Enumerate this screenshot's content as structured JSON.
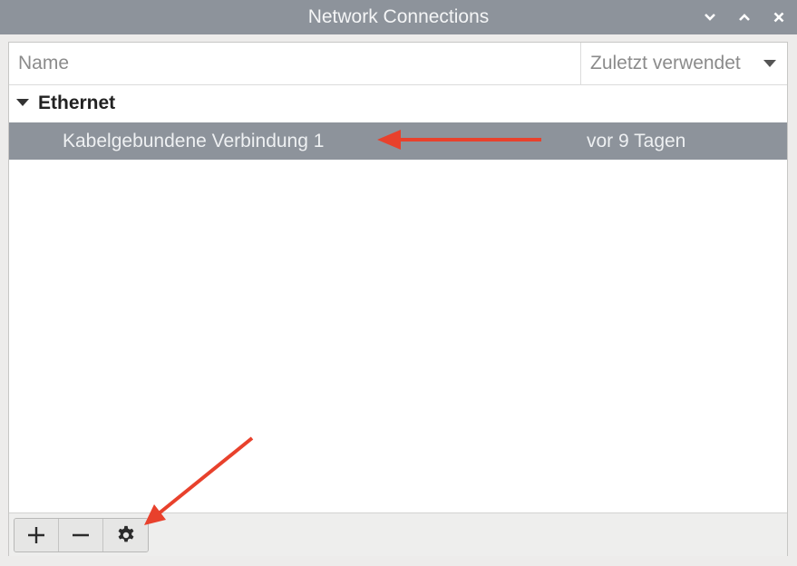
{
  "window": {
    "title": "Network Connections",
    "controls": [
      "chevron-down-icon",
      "chevron-up-icon",
      "close-icon"
    ]
  },
  "list": {
    "columns": {
      "name": "Name",
      "last_used": "Zuletzt verwendet"
    },
    "groups": [
      {
        "label": "Ethernet",
        "expanded": true,
        "connections": [
          {
            "name": "Kabelgebundene Verbindung 1",
            "last_used": "vor 9 Tagen",
            "selected": true
          }
        ]
      }
    ]
  },
  "toolbar": {
    "buttons": [
      "plus-icon",
      "minus-icon",
      "gear-icon"
    ]
  },
  "colors": {
    "titlebar": "#8d939b",
    "selection": "#8d939b",
    "annotation_arrow": "#e8412c"
  }
}
